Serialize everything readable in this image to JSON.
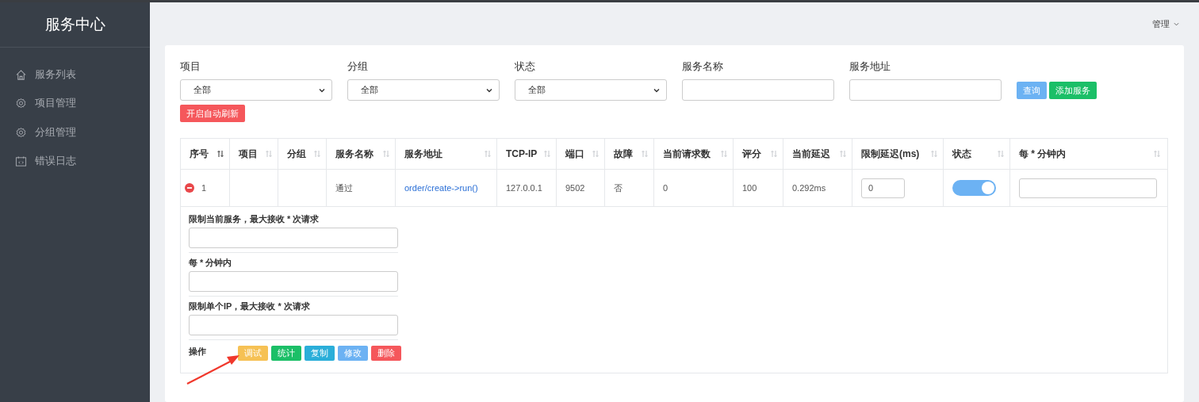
{
  "sidebar": {
    "title": "服务中心",
    "items": [
      {
        "label": "服务列表",
        "kind": "home",
        "selected": false
      },
      {
        "label": "项目管理",
        "kind": "settings",
        "selected": false
      },
      {
        "label": "分组管理",
        "kind": "settings",
        "selected": false
      },
      {
        "label": "错误日志",
        "kind": "log",
        "selected": false
      }
    ]
  },
  "header": {
    "user_menu": "管理"
  },
  "filters": [
    {
      "label": "项目",
      "kind": "select",
      "value": "全部"
    },
    {
      "label": "分组",
      "kind": "select",
      "value": "全部"
    },
    {
      "label": "状态",
      "kind": "select",
      "value": "全部"
    },
    {
      "label": "服务名称",
      "kind": "text"
    },
    {
      "label": "服务地址",
      "kind": "text"
    }
  ],
  "filter_buttons": [
    {
      "label": "查询",
      "color": "#6cb2f3"
    },
    {
      "label": "添加服务",
      "color": "#1bbf67"
    }
  ],
  "auto_refresh_button": "开启自动刷新",
  "table": {
    "columns": [
      {
        "label": "序号",
        "sorted": true
      },
      {
        "label": "项目",
        "sorted": false
      },
      {
        "label": "分组",
        "sorted": false
      },
      {
        "label": "服务名称",
        "sorted": false
      },
      {
        "label": "服务地址",
        "sorted": false
      },
      {
        "label": "TCP-IP",
        "sorted": false
      },
      {
        "label": "端口",
        "sorted": false
      },
      {
        "label": "故障",
        "sorted": false
      },
      {
        "label": "当前请求数",
        "sorted": false
      },
      {
        "label": "评分",
        "sorted": false
      },
      {
        "label": "当前延迟",
        "sorted": false
      },
      {
        "label": "限制延迟(ms)",
        "sorted": false
      },
      {
        "label": "状态",
        "sorted": false
      },
      {
        "label": "每 * 分钟内",
        "sorted": false
      }
    ],
    "rows": [
      {
        "expanded": true,
        "index": "1",
        "name": "通过",
        "address": "order/create->run()",
        "ip": "127.0.0.1",
        "port": "9502",
        "fault": "否",
        "requests": "0",
        "score": "100",
        "latency": "0.292ms",
        "limit_latency": "0",
        "status_on": true,
        "detail": {
          "fields": [
            {
              "label": "限制当前服务，最大接收 * 次请求"
            },
            {
              "label": "每 * 分钟内"
            },
            {
              "label": "限制单个IP，最大接收 * 次请求"
            }
          ],
          "actions_label": "操作",
          "actions": [
            {
              "label": "调试",
              "color": "#f6c154"
            },
            {
              "label": "统计",
              "color": "#1bbf67"
            },
            {
              "label": "复制",
              "color": "#2aaed9"
            },
            {
              "label": "修改",
              "color": "#6cb2f3"
            },
            {
              "label": "删除",
              "color": "#f5575b"
            }
          ]
        }
      }
    ]
  }
}
